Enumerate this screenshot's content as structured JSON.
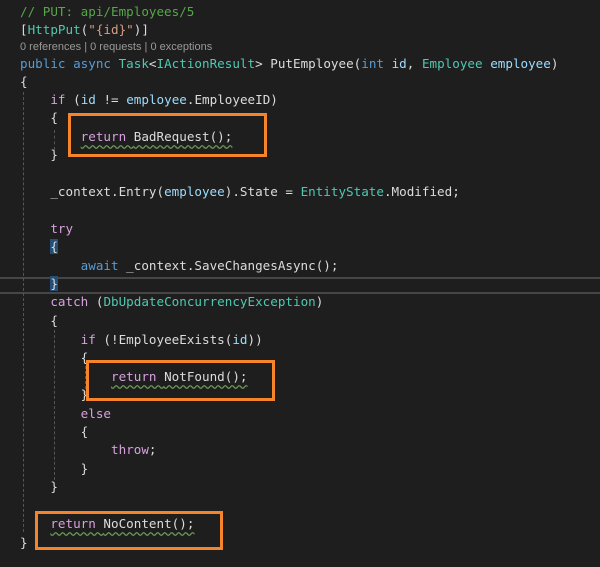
{
  "code_lens": "0 references | 0 requests | 0 exceptions",
  "lines": [
    {
      "tokens": [
        [
          "// PUT: api/Employees/5",
          "cm"
        ]
      ]
    },
    {
      "tokens": [
        [
          "[",
          "pl"
        ],
        [
          "HttpPut",
          "ty"
        ],
        [
          "(",
          "pl"
        ],
        [
          "\"{id}\"",
          "str"
        ],
        [
          ")]",
          "pl"
        ]
      ]
    },
    {
      "lens": true
    },
    {
      "tokens": [
        [
          "public async ",
          "kw"
        ],
        [
          "Task",
          "ty"
        ],
        [
          "<",
          "pl"
        ],
        [
          "IActionResult",
          "ty"
        ],
        [
          "> PutEmployee(",
          "pl"
        ],
        [
          "int ",
          "kw"
        ],
        [
          "id",
          "var"
        ],
        [
          ", ",
          "pl"
        ],
        [
          "Employee ",
          "ty"
        ],
        [
          "employee",
          "var"
        ],
        [
          ")",
          "pl"
        ]
      ]
    },
    {
      "tokens": [
        [
          "{",
          "pl"
        ]
      ]
    },
    {
      "tokens": [
        [
          "    ",
          "pl"
        ],
        [
          "if ",
          "ctl"
        ],
        [
          "(",
          "pl"
        ],
        [
          "id",
          "var"
        ],
        [
          " != ",
          "pl"
        ],
        [
          "employee",
          "var"
        ],
        [
          ".EmployeeID)",
          "pl"
        ]
      ]
    },
    {
      "tokens": [
        [
          "    {",
          "pl"
        ]
      ]
    },
    {
      "tokens": [
        [
          "        ",
          "pl"
        ],
        [
          "return ",
          "ctl sq"
        ],
        [
          "BadRequest();",
          "pl sq"
        ]
      ]
    },
    {
      "tokens": [
        [
          "    }",
          "pl"
        ]
      ]
    },
    {
      "tokens": []
    },
    {
      "tokens": [
        [
          "    _context.Entry(",
          "pl"
        ],
        [
          "employee",
          "var"
        ],
        [
          ").State = ",
          "pl"
        ],
        [
          "EntityState",
          "ty"
        ],
        [
          ".Modified;",
          "pl"
        ]
      ]
    },
    {
      "tokens": []
    },
    {
      "tokens": [
        [
          "    ",
          "pl"
        ],
        [
          "try",
          "ctl"
        ]
      ]
    },
    {
      "tokens": [
        [
          "    ",
          "pl"
        ],
        [
          "{",
          "pl br"
        ]
      ]
    },
    {
      "tokens": [
        [
          "        ",
          "pl"
        ],
        [
          "await ",
          "kw"
        ],
        [
          "_context.SaveChangesAsync();",
          "pl"
        ]
      ]
    },
    {
      "tokens": [
        [
          "    ",
          "pl"
        ],
        [
          "}",
          "pl br"
        ]
      ]
    },
    {
      "tokens": [
        [
          "    ",
          "pl"
        ],
        [
          "catch ",
          "ctl"
        ],
        [
          "(",
          "pl"
        ],
        [
          "DbUpdateConcurrencyException",
          "ty"
        ],
        [
          ")",
          "pl"
        ]
      ]
    },
    {
      "tokens": [
        [
          "    {",
          "pl"
        ]
      ]
    },
    {
      "tokens": [
        [
          "        ",
          "pl"
        ],
        [
          "if ",
          "ctl"
        ],
        [
          "(!EmployeeExists(",
          "pl"
        ],
        [
          "id",
          "var"
        ],
        [
          "))",
          "pl"
        ]
      ]
    },
    {
      "tokens": [
        [
          "        {",
          "pl"
        ]
      ]
    },
    {
      "tokens": [
        [
          "            ",
          "pl"
        ],
        [
          "return ",
          "ctl sq"
        ],
        [
          "NotFound();",
          "pl sq"
        ]
      ]
    },
    {
      "tokens": [
        [
          "        }",
          "pl"
        ]
      ]
    },
    {
      "tokens": [
        [
          "        ",
          "pl"
        ],
        [
          "else",
          "ctl"
        ]
      ]
    },
    {
      "tokens": [
        [
          "        {",
          "pl"
        ]
      ]
    },
    {
      "tokens": [
        [
          "            ",
          "pl"
        ],
        [
          "throw",
          "ctl"
        ],
        [
          ";",
          "pl"
        ]
      ]
    },
    {
      "tokens": [
        [
          "        }",
          "pl"
        ]
      ]
    },
    {
      "tokens": [
        [
          "    }",
          "pl"
        ]
      ]
    },
    {
      "tokens": []
    },
    {
      "tokens": [
        [
          "    ",
          "pl"
        ],
        [
          "return ",
          "ctl sq"
        ],
        [
          "NoContent();",
          "pl sq"
        ]
      ]
    },
    {
      "tokens": [
        [
          "}",
          "pl"
        ]
      ]
    }
  ]
}
